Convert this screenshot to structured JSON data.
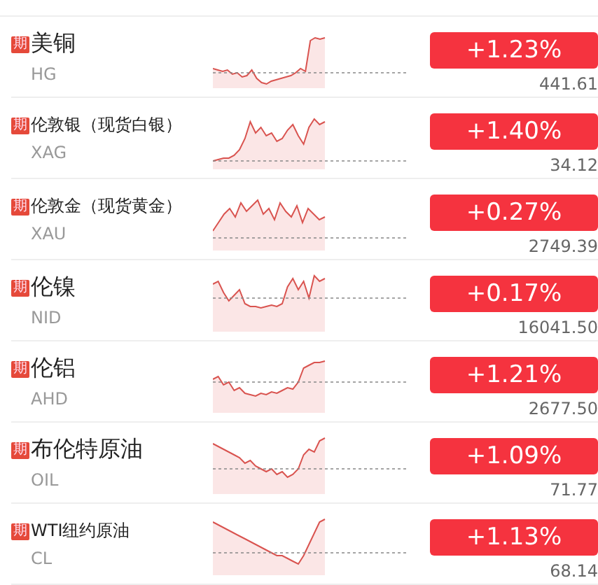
{
  "quotes": [
    {
      "badge": "期",
      "name": "美铜",
      "code": "HG",
      "change": "+1.23%",
      "price": "441.61"
    },
    {
      "badge": "期",
      "name": "伦敦银（现货白银）",
      "code": "XAG",
      "change": "+1.40%",
      "price": "34.12"
    },
    {
      "badge": "期",
      "name": "伦敦金（现货黄金）",
      "code": "XAU",
      "change": "+0.27%",
      "price": "2749.39"
    },
    {
      "badge": "期",
      "name": "伦镍",
      "code": "NID",
      "change": "+0.17%",
      "price": "16041.50"
    },
    {
      "badge": "期",
      "name": "伦铝",
      "code": "AHD",
      "change": "+1.21%",
      "price": "2677.50"
    },
    {
      "badge": "期",
      "name": "布伦特原油",
      "code": "OIL",
      "change": "+1.09%",
      "price": "71.77"
    },
    {
      "badge": "期",
      "name": "WTI纽约原油",
      "code": "CL",
      "change": "+1.13%",
      "price": "68.14"
    }
  ]
}
